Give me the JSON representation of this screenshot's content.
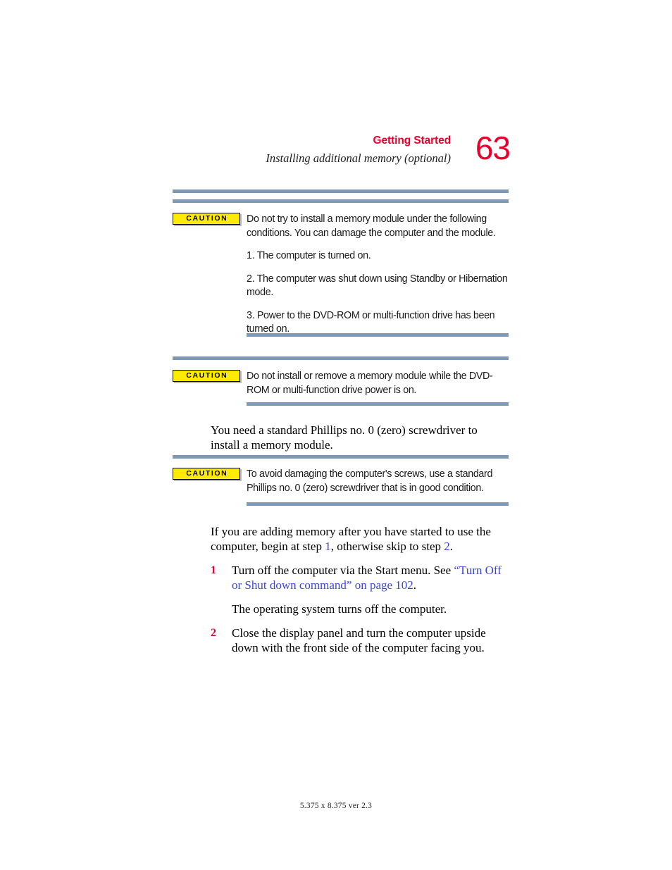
{
  "header": {
    "chapter": "Getting Started",
    "section": "Installing additional memory (optional)",
    "page_number": "63",
    "chapter_color": "#e8002a",
    "page_number_color": "#e8002a"
  },
  "rule_color": "#7e99b5",
  "caution_badge_label": "CAUTION",
  "caution_badge_bg": "#ffeb00",
  "cautions": [
    {
      "label": "CAUTION",
      "paragraphs": [
        "Do not try to install a memory module under the following conditions. You can damage the computer and the module.",
        "1. The computer is turned on.",
        "2. The computer was shut down using Standby or Hibernation mode.",
        "3. Power to the DVD-ROM or multi-function drive has been turned on."
      ]
    },
    {
      "label": "CAUTION",
      "paragraphs": [
        "Do not install or remove a memory module while the DVD-ROM or multi-function drive power is on."
      ]
    },
    {
      "label": "CAUTION",
      "paragraphs": [
        "To avoid damaging the computer's screws, use a standard Phillips no. 0 (zero) screwdriver that is in good condition."
      ]
    }
  ],
  "body": {
    "screwdriver_paragraph": "You need a standard Phillips no. 0 (zero) screwdriver to install a memory module."
  },
  "steps_intro": {
    "text_before_first_ref": "If you are adding memory after you have started to use the computer, begin at step ",
    "first_ref": "1",
    "text_between_refs": ", otherwise skip to step ",
    "second_ref": "2",
    "text_after_second_ref": "."
  },
  "steps": [
    {
      "number": "1",
      "text_before_link": "Turn off the computer via the Start menu. See ",
      "link_text": "“Turn Off or Shut down command” on page 102",
      "text_after_link": ".",
      "sub_text": "The operating system turns off the computer."
    },
    {
      "number": "2",
      "text_before_link": "Close the display panel and turn the computer upside down with the front side of the computer facing you.",
      "link_text": "",
      "text_after_link": "",
      "sub_text": ""
    }
  ],
  "link_color": "#3b44d8",
  "step_number_color": "#d1002e",
  "footer": {
    "text": "5.375 x 8.375 ver 2.3"
  }
}
